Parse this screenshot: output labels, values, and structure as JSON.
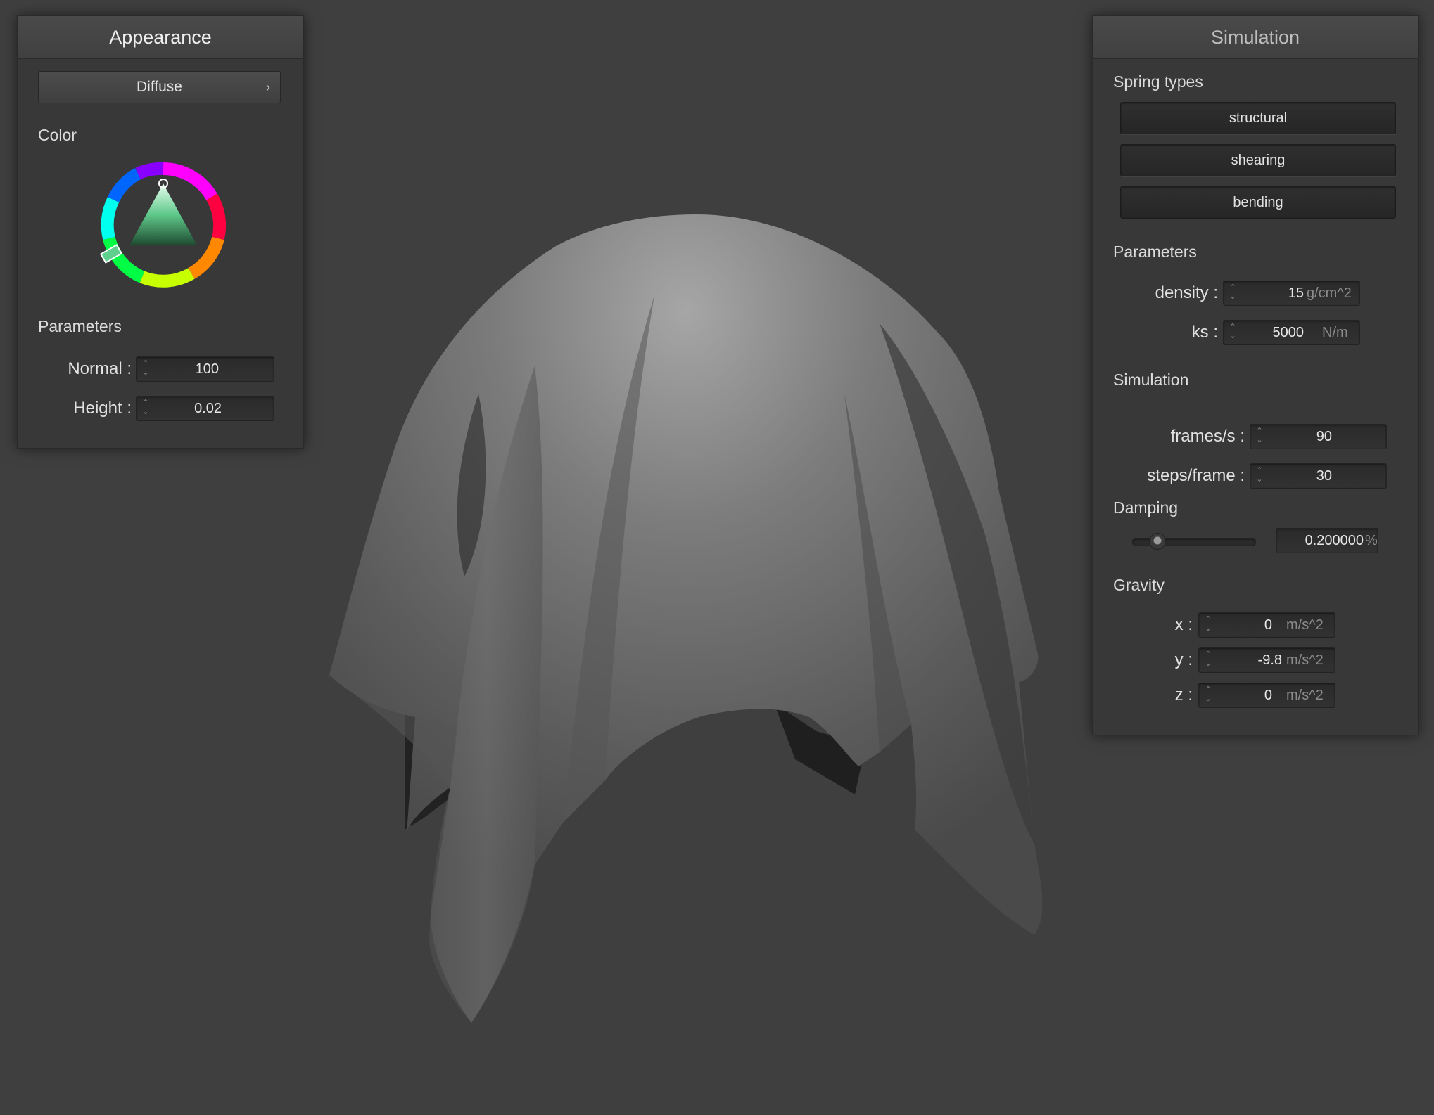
{
  "appearance": {
    "title": "Appearance",
    "shader": {
      "label": "Diffuse",
      "chevron": "›"
    },
    "color_label": "Color",
    "params_label": "Parameters",
    "normal": {
      "label": "Normal :",
      "value": "100"
    },
    "height": {
      "label": "Height :",
      "value": "0.02"
    }
  },
  "simulation": {
    "title": "Simulation",
    "spring_types_label": "Spring types",
    "spring_types": [
      "structural",
      "shearing",
      "bending"
    ],
    "params_label": "Parameters",
    "density": {
      "label": "density :",
      "value": "15",
      "unit": "g/cm^2"
    },
    "ks": {
      "label": "ks :",
      "value": "5000",
      "unit": "N/m"
    },
    "sim_label": "Simulation",
    "fps": {
      "label": "frames/s :",
      "value": "90"
    },
    "steps": {
      "label": "steps/frame :",
      "value": "30"
    },
    "damping_label": "Damping",
    "damping": {
      "value": "0.200000",
      "unit": "%",
      "fraction": 0.2
    },
    "gravity_label": "Gravity",
    "gx": {
      "label": "x :",
      "value": "0",
      "unit": "m/s^2"
    },
    "gy": {
      "label": "y :",
      "value": "-9.8",
      "unit": "m/s^2"
    },
    "gz": {
      "label": "z :",
      "value": "0",
      "unit": "m/s^2"
    }
  },
  "icons": {
    "spin_arrows": "spinbox-arrows-icon",
    "chevron": "chevron-right-icon",
    "color_wheel": "color-wheel-icon"
  },
  "colors": {
    "background": "#3f3f3f",
    "panel": "#383838",
    "cloth": "#6e6e6e"
  }
}
